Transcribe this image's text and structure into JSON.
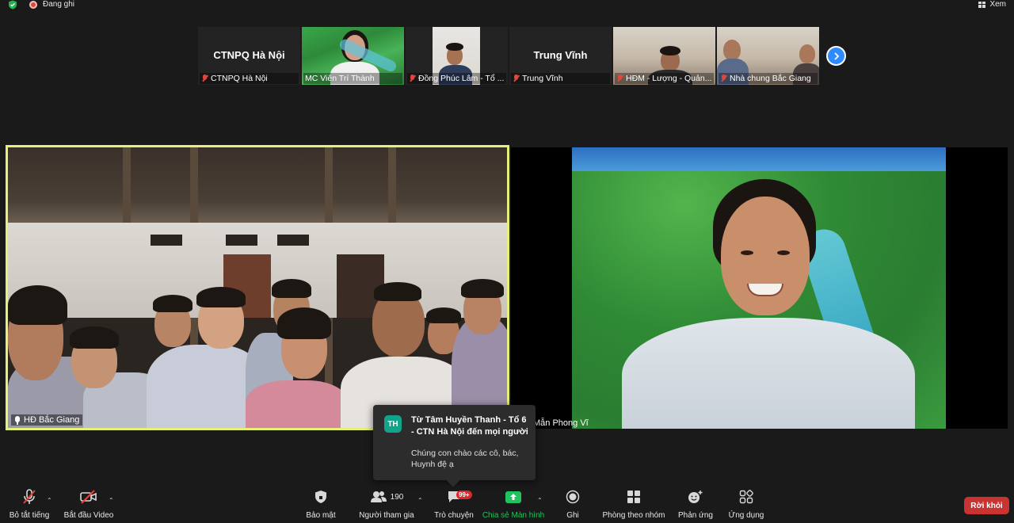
{
  "topbar": {
    "recording_label": "Đang ghi",
    "view_label": "Xem",
    "icons": [
      "shield-check-icon",
      "record-icon",
      "grid-view-icon"
    ]
  },
  "strip": {
    "tiles": [
      {
        "label": "CTNPQ Hà Nội",
        "big_name": "CTNPQ Hà Nội",
        "muted": true
      },
      {
        "label": "MC Viên Trí Thành",
        "muted": false
      },
      {
        "label": "Đồng Phúc Lâm - Tổ ...",
        "muted": true
      },
      {
        "label": "Trung Vĩnh",
        "big_name": "Trung Vĩnh",
        "muted": true
      },
      {
        "label": "HĐM - Lượng - Quản...",
        "muted": true
      },
      {
        "label": "Nhà chung Bắc Giang",
        "muted": true
      }
    ]
  },
  "main_videos": {
    "left_label": "HĐ Bắc Giang",
    "right_label": "Mẫn Phong Vĩ",
    "accent_color": "#e4f07a"
  },
  "chat_popup": {
    "avatar_initials": "TH",
    "from": "Từ Tâm Huyền Thanh - Tổ 6 - CTN Hà Nội đến mọi người",
    "message": "Chúng con chào các cô, bác, Huynh đệ ạ"
  },
  "toolbar": {
    "mute_all": "Bỏ tắt tiếng",
    "start_video": "Bắt đầu Video",
    "security": "Bảo mật",
    "participants": "Người tham gia",
    "participants_count": "190",
    "chat": "Trò chuyện",
    "chat_badge": "99+",
    "share_screen": "Chia sẻ Màn hình",
    "record": "Ghi",
    "breakout_rooms": "Phòng theo nhóm",
    "reactions": "Phản ứng",
    "apps": "Ứng dụng",
    "leave": "Rời khỏi",
    "share_color": "#21c35f",
    "leave_color": "#c93331"
  }
}
